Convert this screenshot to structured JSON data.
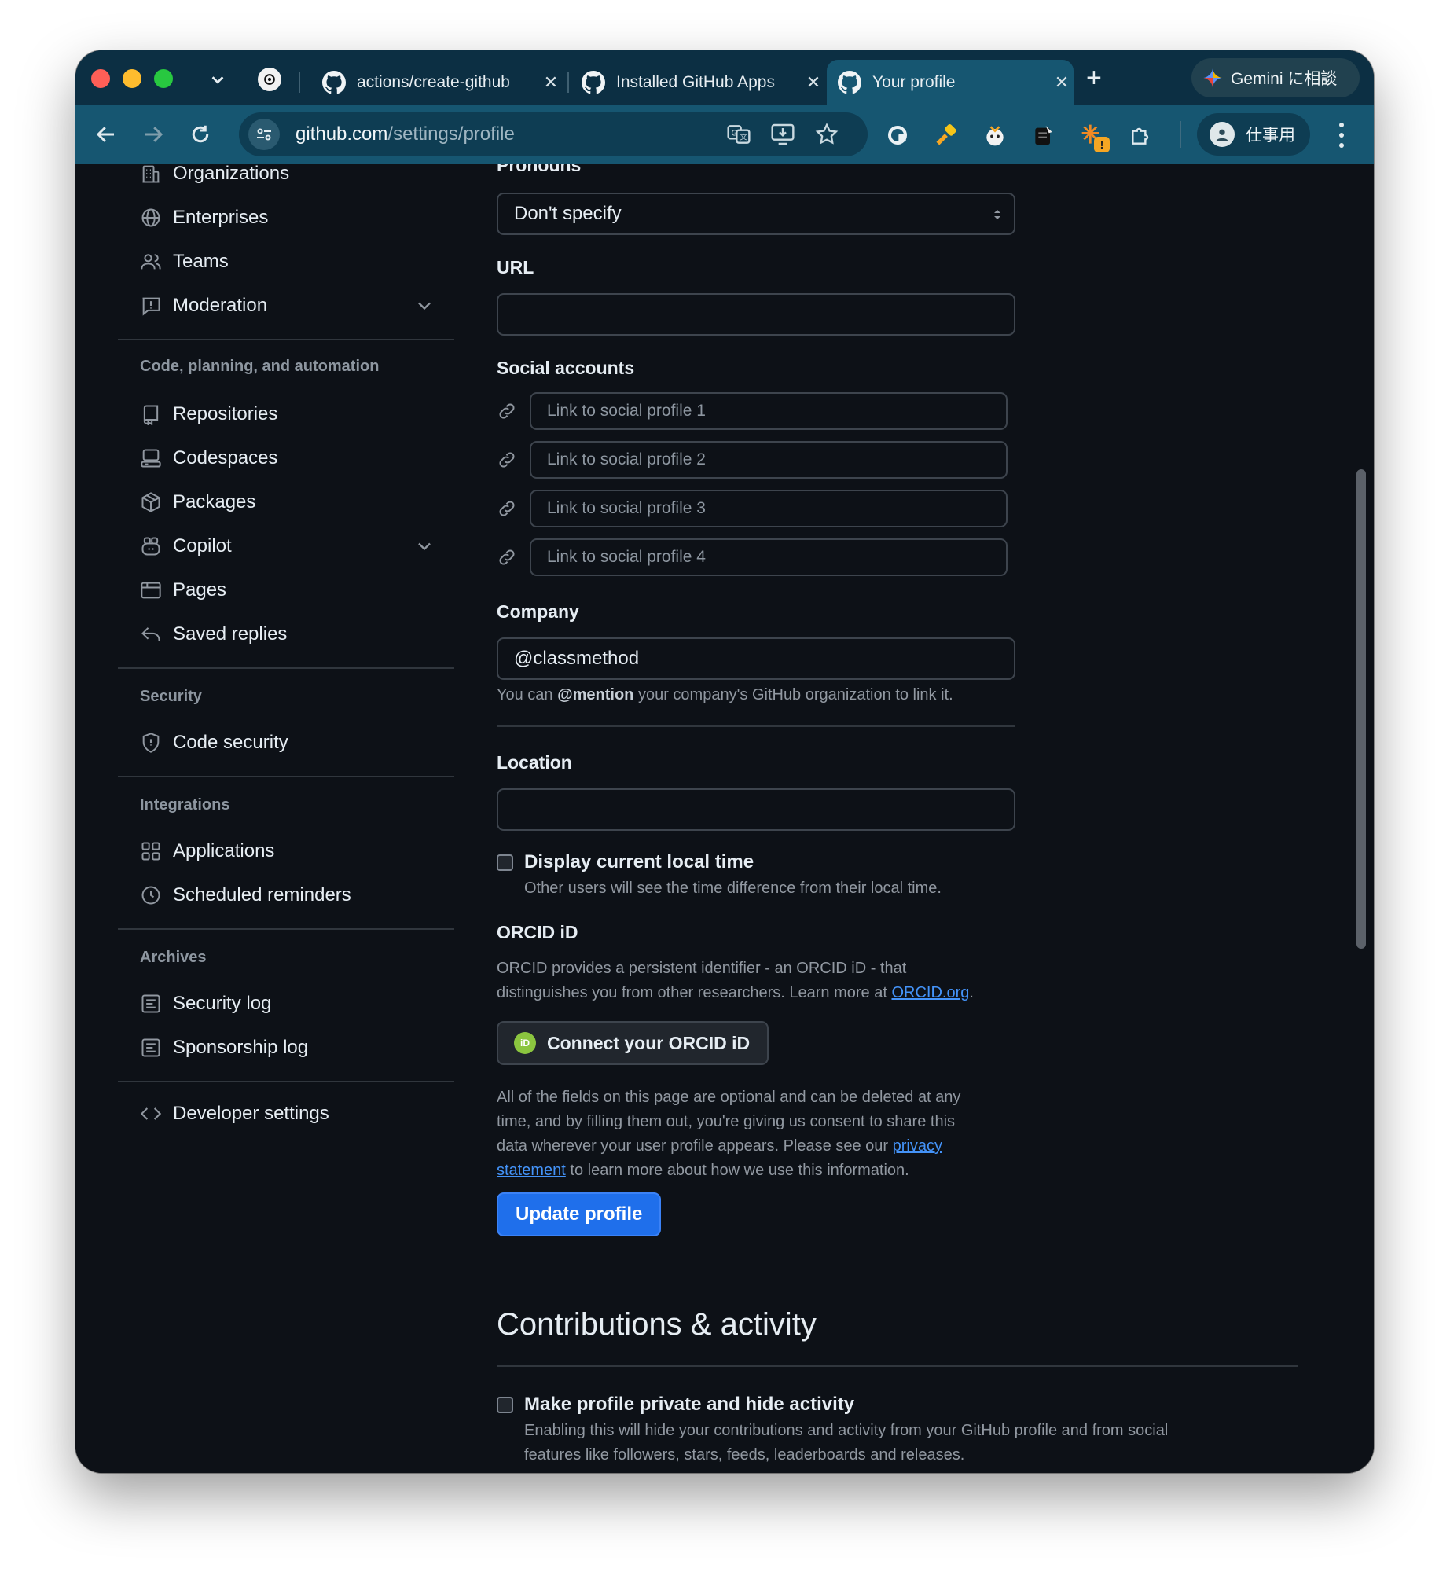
{
  "browser": {
    "tabs": [
      {
        "title": "actions/create-github",
        "active": false
      },
      {
        "title": "Installed GitHub Apps",
        "active": false
      },
      {
        "title": "Your profile",
        "active": true
      }
    ],
    "new_tab_label": "+",
    "gemini_label": "Gemini に相談",
    "url_host": "github.com",
    "url_path": "/settings/profile",
    "profile_label": "仕事用",
    "extension_badge": "!"
  },
  "sidebar": {
    "top_items": [
      {
        "label": "Organizations",
        "icon": "organization-icon"
      },
      {
        "label": "Enterprises",
        "icon": "globe-icon"
      },
      {
        "label": "Teams",
        "icon": "people-icon"
      },
      {
        "label": "Moderation",
        "icon": "report-icon",
        "expandable": true
      }
    ],
    "code_section": {
      "heading": "Code, planning, and automation",
      "items": [
        {
          "label": "Repositories",
          "icon": "repo-icon"
        },
        {
          "label": "Codespaces",
          "icon": "codespaces-icon"
        },
        {
          "label": "Packages",
          "icon": "package-icon"
        },
        {
          "label": "Copilot",
          "icon": "copilot-icon",
          "expandable": true
        },
        {
          "label": "Pages",
          "icon": "browser-icon"
        },
        {
          "label": "Saved replies",
          "icon": "reply-icon"
        }
      ]
    },
    "security_section": {
      "heading": "Security",
      "items": [
        {
          "label": "Code security",
          "icon": "shield-icon"
        }
      ]
    },
    "integrations_section": {
      "heading": "Integrations",
      "items": [
        {
          "label": "Applications",
          "icon": "apps-icon"
        },
        {
          "label": "Scheduled reminders",
          "icon": "clock-icon"
        }
      ]
    },
    "archives_section": {
      "heading": "Archives",
      "items": [
        {
          "label": "Security log",
          "icon": "log-icon"
        },
        {
          "label": "Sponsorship log",
          "icon": "log-icon"
        }
      ]
    },
    "developer_settings": {
      "label": "Developer settings",
      "icon": "code-icon"
    }
  },
  "profile": {
    "pronouns_label": "Pronouns",
    "pronouns_value": "Don't specify",
    "url_label": "URL",
    "url_value": "",
    "social_label": "Social accounts",
    "social_placeholders": [
      "Link to social profile 1",
      "Link to social profile 2",
      "Link to social profile 3",
      "Link to social profile 4"
    ],
    "company_label": "Company",
    "company_value": "@classmethod",
    "company_note_prefix": "You can ",
    "company_note_bold": "@mention",
    "company_note_suffix": " your company's GitHub organization to link it.",
    "location_label": "Location",
    "location_value": "",
    "local_time_label": "Display current local time",
    "local_time_desc": "Other users will see the time difference from their local time.",
    "orcid_title": "ORCID iD",
    "orcid_desc_line1": "ORCID provides a persistent identifier - an ORCID iD - that",
    "orcid_desc_line2_prefix": "distinguishes you from other researchers. Learn more at ",
    "orcid_link": "ORCID.org",
    "orcid_desc_suffix": ".",
    "orcid_logo_text": "iD",
    "orcid_button": "Connect your ORCID iD",
    "optional_line1": "All of the fields on this page are optional and can be deleted at any",
    "optional_line2": "time, and by filling them out, you're giving us consent to share this",
    "optional_line3_prefix": "data wherever your user profile appears. Please see our ",
    "privacy_link_1": "privacy",
    "privacy_link_2": "statement",
    "optional_line4_suffix": " to learn more about how we use this information.",
    "update_button": "Update profile"
  },
  "contributions": {
    "title": "Contributions & activity",
    "private_label": "Make profile private and hide activity",
    "private_desc_line1": "Enabling this will hide your contributions and activity from your GitHub profile and from social",
    "private_desc_line2": "features like followers, stars, feeds, leaderboards and releases."
  },
  "colors": {
    "accent": "#1f6feb",
    "link": "#4493f8",
    "chrome_tabbar": "#0c2f43",
    "chrome_toolbar": "#165671",
    "page_bg": "#0d1117"
  }
}
